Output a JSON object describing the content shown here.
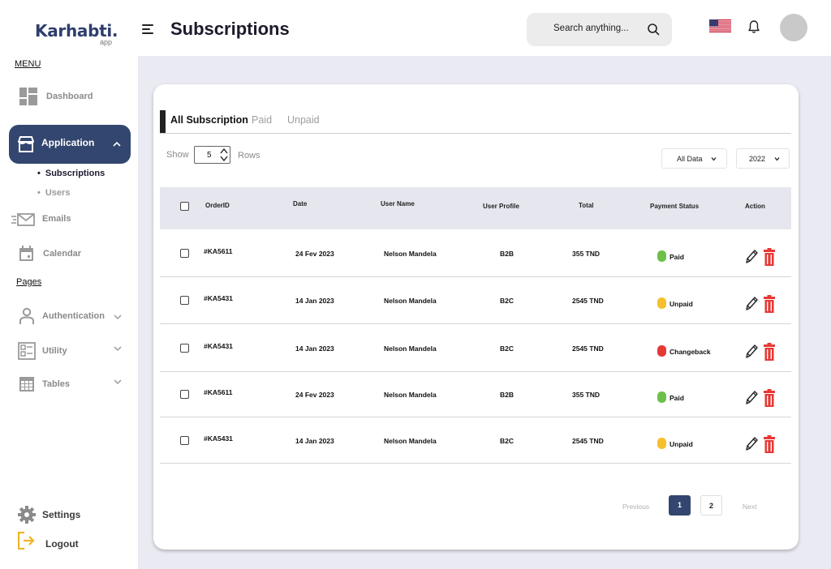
{
  "brand": {
    "name": "Karhabti.",
    "sub": "app"
  },
  "header": {
    "title": "Subscriptions",
    "search_placeholder": "Search anything..."
  },
  "sidebar": {
    "menu_label": "MENU",
    "pages_label": "Pages",
    "items": {
      "dashboard": "Dashboard",
      "application": "Application",
      "subscriptions": "Subscriptions",
      "users": "Users",
      "emails": "Emails",
      "calendar": "Calendar",
      "authentication": "Authentication",
      "utility": "Utility",
      "tables": "Tables",
      "settings": "Settings",
      "logout": "Logout"
    }
  },
  "tabs": [
    "All Subscription",
    "Paid",
    "Unpaid"
  ],
  "controls": {
    "show_label": "Show",
    "rows_label": "Rows",
    "rows_value": "5",
    "filter": "All Data",
    "year": "2022"
  },
  "table": {
    "columns": [
      "OrderID",
      "Date",
      "User Name",
      "User Profile",
      "Total",
      "Payment Status",
      "Action"
    ],
    "rows": [
      {
        "id": "#KA5611",
        "date": "24 Fev 2023",
        "user": "Nelson Mandela",
        "profile": "B2B",
        "total": "355 TND",
        "status": "Paid"
      },
      {
        "id": "#KA5431",
        "date": "14 Jan 2023",
        "user": "Nelson Mandela",
        "profile": "B2C",
        "total": "2545 TND",
        "status": "Unpaid"
      },
      {
        "id": "#KA5431",
        "date": "14 Jan 2023",
        "user": "Nelson Mandela",
        "profile": "B2C",
        "total": "2545 TND",
        "status": "Changeback"
      },
      {
        "id": "#KA5611",
        "date": "24 Fev 2023",
        "user": "Nelson Mandela",
        "profile": "B2B",
        "total": "355 TND",
        "status": "Paid"
      },
      {
        "id": "#KA5431",
        "date": "14 Jan 2023",
        "user": "Nelson Mandela",
        "profile": "B2C",
        "total": "2545 TND",
        "status": "Unpaid"
      }
    ]
  },
  "status_colors": {
    "Paid": "#6cc04a",
    "Unpaid": "#f5c02d",
    "Changeback": "#e53935"
  },
  "pagination": {
    "previous": "Previous",
    "next": "Next",
    "pages": [
      "1",
      "2"
    ],
    "current": "1"
  },
  "colors": {
    "accent": "#33466f",
    "danger": "#e53935",
    "background": "#eaeaf3"
  }
}
